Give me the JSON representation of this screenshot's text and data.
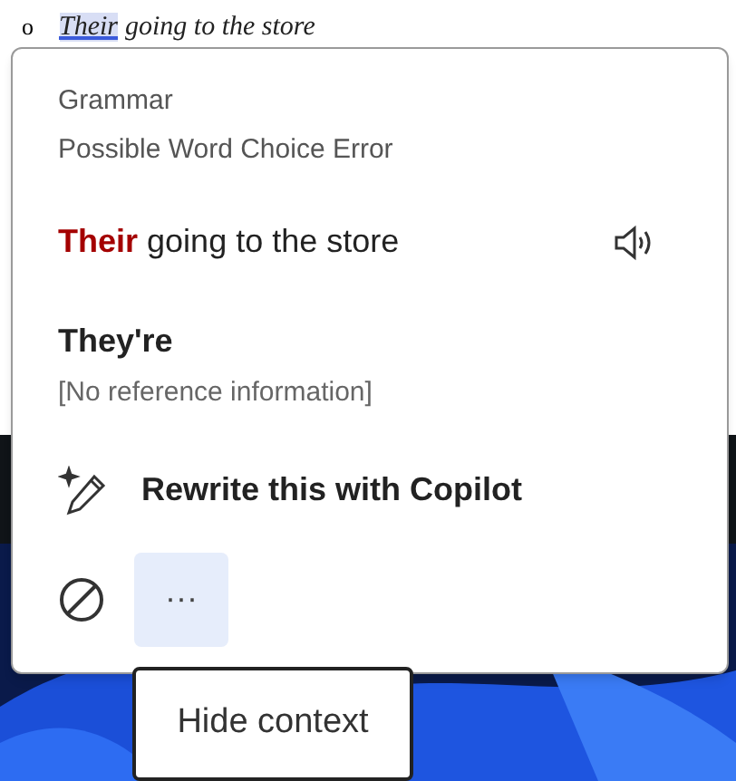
{
  "document": {
    "bullet": "o",
    "line": [
      {
        "text": "Their",
        "flagged": true
      },
      {
        "text": "going to the store",
        "flagged": false
      }
    ]
  },
  "popup": {
    "category": "Grammar",
    "issue": "Possible Word Choice Error",
    "sentence": {
      "error_word": "Their",
      "rest": "going to the store"
    },
    "suggestion": {
      "word": "They're",
      "reference": "[No reference information]"
    },
    "copilot_action": "Rewrite this with Copilot",
    "more_button": {
      "label": "···",
      "hovered": true
    }
  },
  "tooltip": "Hide context"
}
